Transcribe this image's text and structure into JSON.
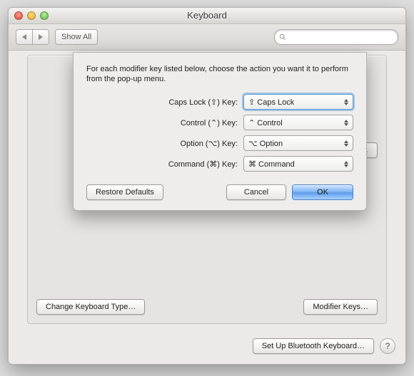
{
  "window": {
    "title": "Keyboard"
  },
  "toolbar": {
    "back_label": "◀",
    "forward_label": "▶",
    "show_all_label": "Show All",
    "search_placeholder": ""
  },
  "panel": {
    "change_type_label": "Change Keyboard Type…",
    "modifier_keys_label": "Modifier Keys…"
  },
  "bg_visible": {
    "input_sources_label": "Input Sources…"
  },
  "footer": {
    "bluetooth_label": "Set Up Bluetooth Keyboard…",
    "help_label": "?"
  },
  "sheet": {
    "description": "For each modifier key listed below, choose the action you want it to perform from the pop-up menu.",
    "rows": [
      {
        "label": "Caps Lock (⇪) Key:",
        "value": "⇪ Caps Lock",
        "focused": true
      },
      {
        "label": "Control (⌃) Key:",
        "value": "⌃ Control",
        "focused": false
      },
      {
        "label": "Option (⌥) Key:",
        "value": "⌥ Option",
        "focused": false
      },
      {
        "label": "Command (⌘) Key:",
        "value": "⌘ Command",
        "focused": false
      }
    ],
    "restore_label": "Restore Defaults",
    "cancel_label": "Cancel",
    "ok_label": "OK"
  }
}
